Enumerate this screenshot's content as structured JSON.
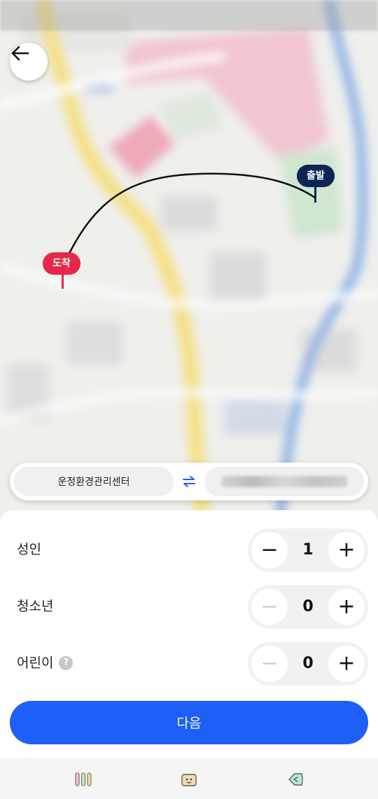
{
  "map": {
    "start_pin_label": "출발",
    "end_pin_label": "도착"
  },
  "route": {
    "from_label": "운정환경관리센터",
    "to_label": ""
  },
  "passengers": [
    {
      "label": "성인",
      "count": "1",
      "minus_enabled": true,
      "has_help": false
    },
    {
      "label": "청소년",
      "count": "0",
      "minus_enabled": false,
      "has_help": false
    },
    {
      "label": "어린이",
      "count": "0",
      "minus_enabled": false,
      "has_help": true
    }
  ],
  "stepper_symbols": {
    "minus": "−",
    "plus": "+"
  },
  "help_symbol": "?",
  "next_button_label": "다음",
  "bottom_nav": {
    "items": [
      "recent-apps-icon",
      "home-icon",
      "back-icon"
    ]
  },
  "colors": {
    "primary": "#1e5ff7",
    "start_pin": "#0d2456",
    "end_pin": "#e8284a"
  }
}
